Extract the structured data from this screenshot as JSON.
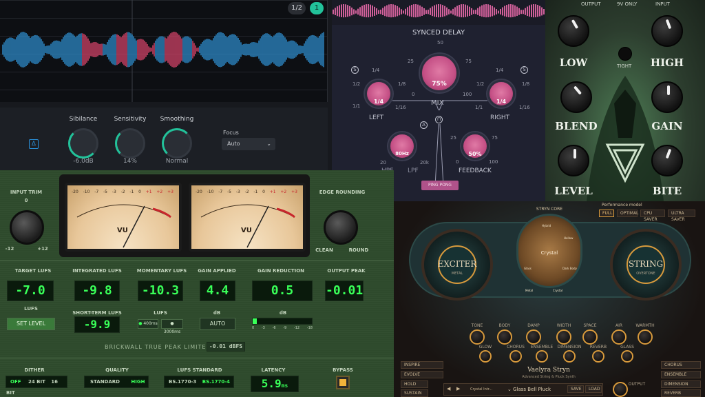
{
  "deesser": {
    "pager": "1/2",
    "pager_active": "1",
    "knobs": [
      {
        "label": "Sibilance",
        "value": "-6.0dB"
      },
      {
        "label": "Sensitivity",
        "value": "14%"
      },
      {
        "label": "Smoothing",
        "value": "Normal"
      }
    ],
    "focus_label": "Focus",
    "focus_value": "Auto",
    "colors": {
      "wave": "#2f8fd0",
      "sibilance": "#d9456a",
      "accent": "#22c29a"
    }
  },
  "delay": {
    "title": "SYNCED DELAY",
    "mix": {
      "label": "MIX",
      "value": "75%",
      "scale_top": "50",
      "scale_left": "25",
      "scale_right": "75",
      "scale_min": "0",
      "scale_max": "100"
    },
    "left": {
      "label": "LEFT",
      "value": "1/4",
      "badge": "S",
      "s1": "1/4",
      "s2": "1/2",
      "s3": "1/8",
      "s4": "1/1",
      "s5": "1/16"
    },
    "right": {
      "label": "RIGHT",
      "value": "1/4",
      "badge": "S",
      "s1": "1/4",
      "s2": "1/2",
      "s3": "1/8",
      "s4": "1/1",
      "s5": "1/16"
    },
    "lpf": {
      "label": "LPF",
      "value": "80Hz",
      "min": "20",
      "max": "20k",
      "badge": "A"
    },
    "hpf_label": "HPF",
    "feedback": {
      "label": "FEEDBACK",
      "value": "50%",
      "s_left": "25",
      "s_right": "75",
      "min": "0",
      "max": "100"
    },
    "link_icon": "link-icon",
    "bottom_button": "PING PONG",
    "colors": {
      "knob": "#d0609a",
      "bg": "#1f2130"
    }
  },
  "pedal": {
    "top_labels": [
      "OUTPUT",
      "9V ONLY",
      "INPUT"
    ],
    "knobs": [
      "LOW",
      "HIGH",
      "BLEND",
      "GAIN",
      "LEVEL",
      "BITE"
    ],
    "tight_label": "TIGHT"
  },
  "limiter": {
    "input_trim": {
      "label": "INPUT TRIM",
      "min": "-12",
      "max": "+12",
      "center": "0"
    },
    "edge_rounding": {
      "label": "EDGE ROUNDING",
      "left": "CLEAN",
      "right": "ROUND"
    },
    "vu_label": "VU",
    "vu_scale": [
      "-20",
      "-10",
      "-7",
      "-5",
      "-3",
      "-2",
      "-1",
      "0",
      "+1",
      "+2",
      "+3"
    ],
    "readouts": [
      {
        "label": "TARGET LUFS",
        "value": "-7.0"
      },
      {
        "label": "INTEGRATED LUFS",
        "value": "-9.8"
      },
      {
        "label": "MOMENTARY LUFS",
        "value": "-10.3"
      },
      {
        "label": "GAIN APPLIED",
        "value": "4.4"
      },
      {
        "label": "GAIN REDUCTION",
        "value": "0.5"
      },
      {
        "label": "OUTPUT PEAK",
        "value": "-0.01"
      }
    ],
    "lufs_sub": "LUFS",
    "set_level": "SET LEVEL",
    "short_term": {
      "label": "SHORT-TERM LUFS",
      "value": "-9.9"
    },
    "lufs_label": "LUFS",
    "window_400": "400ms",
    "window_3000": "3000ms",
    "db_label": "dB",
    "db_label2": "dB",
    "auto": "AUTO",
    "gr_scale": [
      "0",
      "-3",
      "-6",
      "-9",
      "-12",
      "-18"
    ],
    "brickwall": "BRICKWALL TRUE PEAK LIMITER",
    "ceiling": "-0.01 dBFS",
    "dither": {
      "label": "DITHER",
      "off": "OFF",
      "opt1": "24 BIT",
      "opt2": "16 BIT"
    },
    "quality": {
      "label": "QUALITY",
      "std": "STANDARD",
      "high": "HIGH"
    },
    "lufs_standard": {
      "label": "LUFS STANDARD",
      "opt1": "BS.1770-3",
      "opt2": "BS.1770-4"
    },
    "latency": {
      "label": "LATENCY",
      "value": "5.9",
      "unit": "ms"
    },
    "bypass": "BYPASS",
    "colors": {
      "lcd": "#39ff58",
      "panel": "#2e4a2c",
      "bypass": "#f2b23a"
    }
  },
  "stryn": {
    "core_label": "STRYN CORE",
    "perf_label": "Performance model",
    "perf_modes": [
      "FULL",
      "OPTIMAL",
      "CPU SAVER",
      "ULTRA SAVER"
    ],
    "exciter": {
      "label": "EXCITER",
      "sub": "METAL"
    },
    "string": {
      "label": "STRING",
      "sub": "OVERTONE"
    },
    "core_center": "Crystal",
    "core_points": [
      "Hybrid",
      "Glass",
      "Hollow",
      "Dark Body",
      "Metal",
      "Crystal"
    ],
    "knob_row1": [
      "TONE",
      "BODY",
      "DAMP",
      "WIDTH",
      "SPACE",
      "AIR",
      "WARMTH"
    ],
    "knob_row2": [
      "GLOW",
      "CHORUS",
      "ENSEMBLE",
      "DIMENSION",
      "REVERB",
      "GLASS"
    ],
    "brand": "Vaelyra Stryn",
    "brand_sub": "Advanced String & Pluck Synth",
    "left_buttons": [
      "INSPIRE",
      "EVOLVE"
    ],
    "hold_label": "HOLD",
    "sustain_label": "SUSTAIN",
    "preset_category": "Crystal Intr...",
    "preset_name": "Glass Bell Pluck",
    "save": "SAVE",
    "load": "LOAD",
    "output_label": "OUTPUT",
    "right_buttons": [
      "CHORUS",
      "ENSEMBLE",
      "DIMENSION",
      "REVERB"
    ],
    "colors": {
      "accent": "#d89a3c",
      "teal": "#2f6e6a"
    }
  }
}
